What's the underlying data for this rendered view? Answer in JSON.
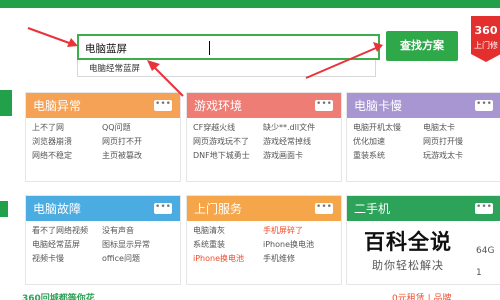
{
  "search": {
    "value": "电脑蓝屏",
    "suggestion": "电脑经常蓝屏",
    "button_label": "查找方案"
  },
  "badge": {
    "line1": "360",
    "line2": "上门修"
  },
  "cards": [
    {
      "title": "电脑异常",
      "more": "•••",
      "links": [
        "上不了网",
        "QQ问题",
        "浏览器崩溃",
        "网页打不开",
        "网络不稳定",
        "主页被篡改"
      ],
      "hot": []
    },
    {
      "title": "游戏环境",
      "more": "•••",
      "links": [
        "CF穿越火线",
        "缺少**.dll文件",
        "网页游戏玩不了",
        "游戏经常掉线",
        "DNF地下城勇士",
        "游戏画面卡"
      ],
      "hot": []
    },
    {
      "title": "电脑卡慢",
      "more": "•••",
      "links": [
        "电脑开机太慢",
        "电脑太卡",
        "优化加速",
        "网页打开慢",
        "重装系统",
        "玩游戏太卡"
      ],
      "hot": []
    },
    {
      "title": "电脑故障",
      "more": "•••",
      "links": [
        "看不了网络视频",
        "没有声音",
        "电脑经常蓝屏",
        "图标显示异常",
        "视频卡慢",
        "office问题"
      ],
      "hot": []
    },
    {
      "title": "上门服务",
      "more": "•••",
      "links": [
        "电脑清灰",
        "手机屏碎了",
        "系统重装",
        "iPhone换电池",
        "iPhone换电池",
        "手机维修"
      ],
      "hot": [
        1,
        4
      ]
    },
    {
      "title": "二手机",
      "more": "•••",
      "links": [],
      "hot": []
    }
  ],
  "watermark": {
    "title": "百科全说",
    "subtitle": "助你轻松解决"
  },
  "side": {
    "storage": "64G",
    "partial": "1"
  },
  "bottom": {
    "left": "360回城都等你花",
    "right": "0元租赁 | 品牌"
  },
  "colors": {
    "brand_green": "#22a04a",
    "arrow_red": "#e8333a",
    "hot_link": "#ef4c2a"
  }
}
